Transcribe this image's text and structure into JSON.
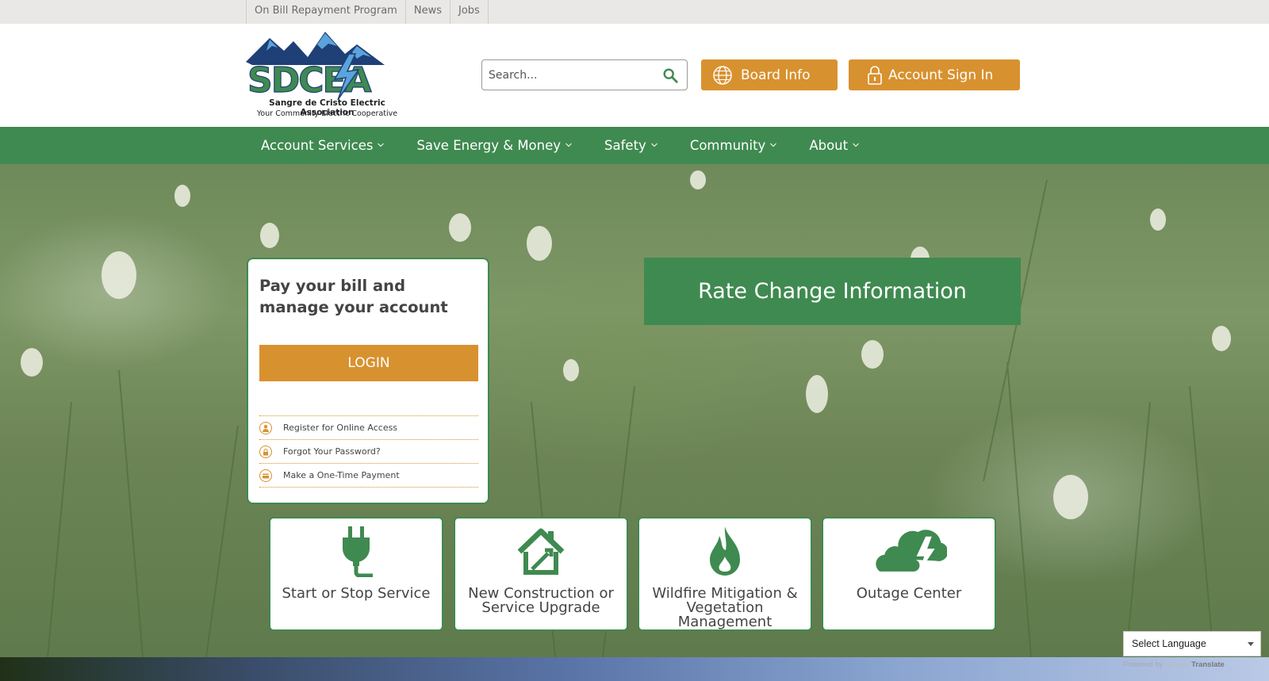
{
  "utility_links": [
    "On Bill Repayment Program",
    "News",
    "Jobs"
  ],
  "logo": {
    "letters": "SDCEA",
    "org_name": "Sangre de Cristo Electric Association",
    "tagline": "Your Community Electric Cooperative"
  },
  "search": {
    "placeholder": "Search..."
  },
  "header_buttons": {
    "board": "Board Info",
    "signin": "Account Sign In"
  },
  "nav": [
    "Account Services",
    "Save Energy & Money",
    "Safety",
    "Community",
    "About"
  ],
  "pay_card": {
    "title": "Pay your bill and manage your account",
    "login": "LOGIN",
    "links": [
      "Register for Online Access",
      "Forgot Your Password?",
      "Make a One-Time Payment"
    ]
  },
  "rate_change": "Rate Change Information",
  "tiles": [
    {
      "label": "Start or Stop Service",
      "icon": "plug-icon"
    },
    {
      "label": "New Construction or Service Upgrade",
      "icon": "house-tools-icon"
    },
    {
      "label": "Wildfire Mitigation & Vegetation Management",
      "icon": "flame-icon"
    },
    {
      "label": "Outage Center",
      "icon": "storm-cloud-icon"
    }
  ],
  "translate": {
    "select_label": "Select Language",
    "powered_by": "Powered by",
    "google": "Google",
    "translate": "Translate"
  },
  "colors": {
    "brand_green": "#3f8a50",
    "accent_orange": "#d8912f",
    "utility_bg": "#e9e8e6"
  }
}
